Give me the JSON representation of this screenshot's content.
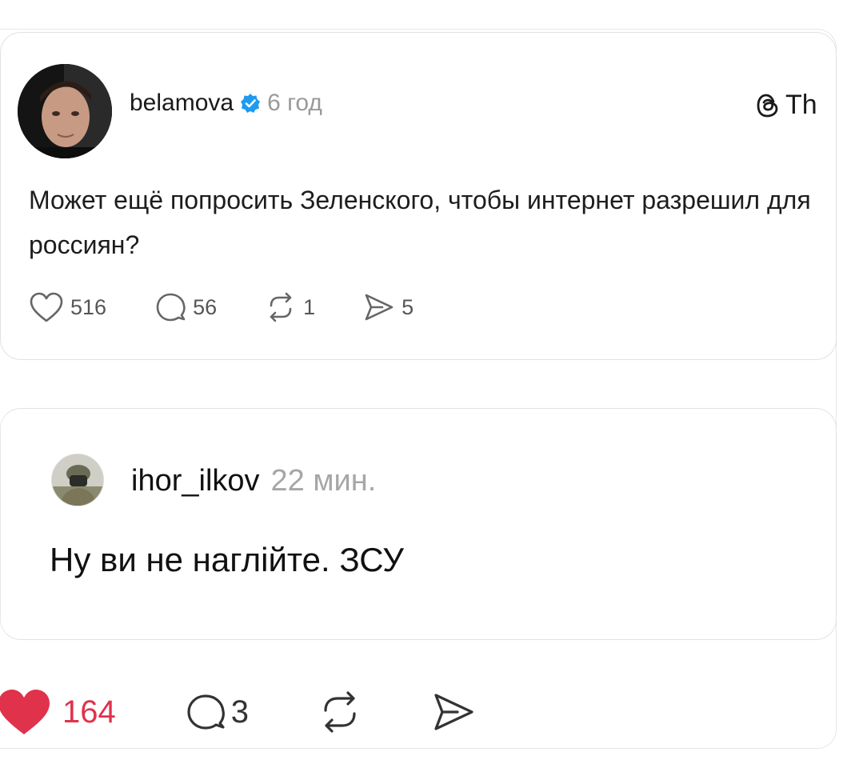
{
  "original_post": {
    "username": "belamova",
    "time": "6 год",
    "brand": "Th",
    "text": "Может ещё попросить Зеленского, чтобы интернет разрешил для россиян?",
    "likes": "516",
    "comments": "56",
    "reposts": "1",
    "shares": "5"
  },
  "reply_post": {
    "username": "ihor_ilkov",
    "time": "22 мин.",
    "text": "Ну ви не наглійте. ЗСУ"
  },
  "bottom_actions": {
    "likes": "164",
    "comments": "3",
    "liked": true
  },
  "colors": {
    "verified": "#1d9bf0",
    "like_red": "#e0324b",
    "muted": "#9a9a9a"
  },
  "icons": [
    "verified-badge-icon",
    "threads-logo-icon",
    "heart-icon",
    "comment-icon",
    "repost-icon",
    "share-icon"
  ]
}
